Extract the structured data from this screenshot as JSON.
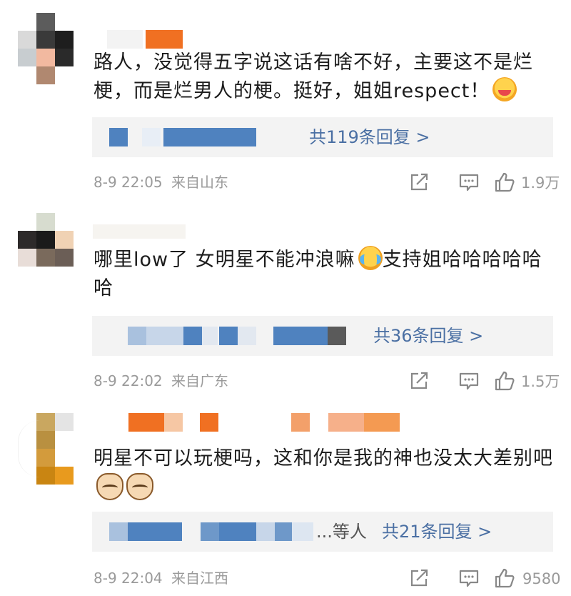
{
  "comments": [
    {
      "text": "路人，没觉得五字说这话有啥不好，主要这不是烂梗，而是烂男人的梗。挺好，姐姐respect！",
      "emoji": "blush-face-icon",
      "replies_label": "共119条回复 >",
      "others_label": "",
      "time": "8-9 22:05",
      "location": "来自山东",
      "likes": "1.9万"
    },
    {
      "text": "哪里low了 女明星不能冲浪嘛",
      "text_after": "支持姐哈哈哈哈哈哈",
      "emoji": "crying-laughing-face-icon",
      "replies_label": "共36条回复 >",
      "others_label": "",
      "time": "8-9 22:02",
      "location": "来自广东",
      "likes": "1.5万"
    },
    {
      "text": "明星不可以玩梗吗，这和你是我的神也没太大差别吧",
      "emoji": "cat-face-icon",
      "replies_label": "共21条回复 >",
      "others_label": "...等人",
      "time": "8-9 22:04",
      "location": "来自江西",
      "likes": "9580"
    }
  ],
  "colors": {
    "reply_blue": "#4a6fa3",
    "meta_gray": "#9a9a9a",
    "reply_bg": "#f3f3f3",
    "censor_orange": "#f07022",
    "censor_blue": "#4f82bf"
  },
  "icons": [
    "share-icon",
    "comment-icon",
    "like-icon"
  ]
}
